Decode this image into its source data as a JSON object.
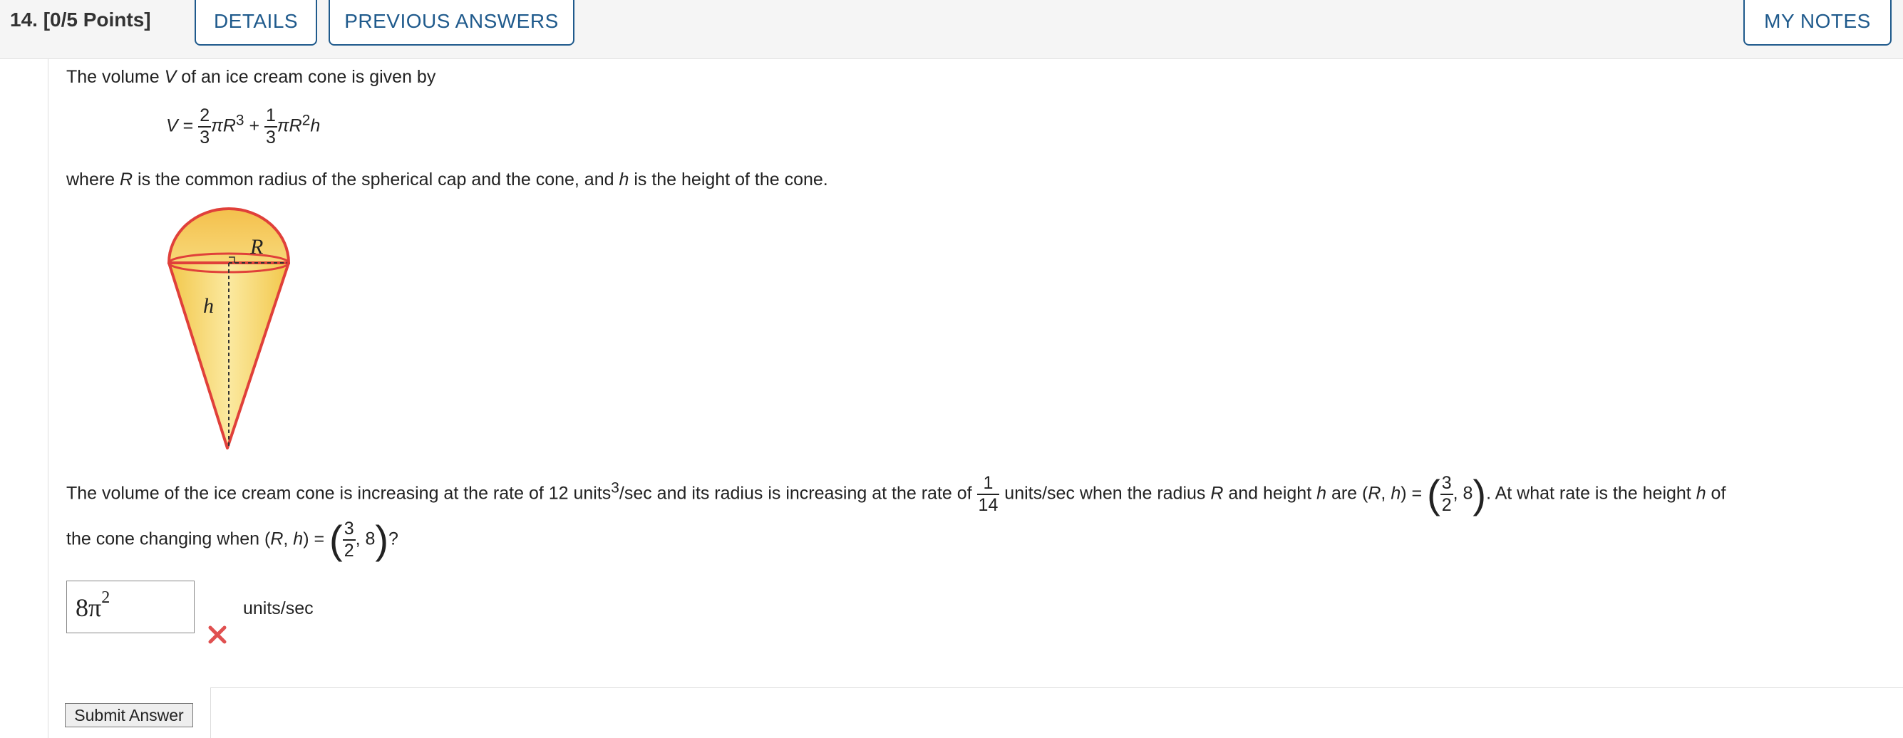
{
  "header": {
    "question_number": "14.",
    "points": "[0/5 Points]",
    "details_label": "DETAILS",
    "previous_answers_label": "PREVIOUS ANSWERS",
    "my_notes_label": "MY NOTES"
  },
  "problem": {
    "intro_pre": "The volume ",
    "intro_var": "V",
    "intro_post": " of an ice cream cone is given by",
    "formula": {
      "lhs": "V",
      "eq": " = ",
      "f1_num": "2",
      "f1_den": "3",
      "t1": "πR",
      "t1_exp": "3",
      "plus": " + ",
      "f2_num": "1",
      "f2_den": "3",
      "t2": "πR",
      "t2_exp": "2",
      "t2_var": "h"
    },
    "where_1": "where ",
    "where_R": "R",
    "where_2": " is the common radius of the spherical cap and the cone, and ",
    "where_h": "h",
    "where_3": " is the height of the cone.",
    "diagram": {
      "label_R": "R",
      "label_h": "h"
    },
    "question": {
      "p1": "The volume of the ice cream cone is increasing at the rate of 12 units",
      "p1_exp": "3",
      "p2": "/sec and its radius is increasing at the rate of ",
      "rate_num": "1",
      "rate_den": "14",
      "p3": " units/sec when the radius ",
      "p3_R": "R",
      "p4": " and height ",
      "p4_h": "h",
      "p5": " are (",
      "p5_R": "R",
      "p5_comma": ", ",
      "p5_h": "h",
      "p6": ") = ",
      "pt_num": "3",
      "pt_den": "2",
      "pt_rest": ", 8",
      "p7": ". At what rate is the height ",
      "p7_h": "h",
      "p8": " of",
      "line2_1": "the cone changing when (",
      "line2_R": "R",
      "line2_comma": ", ",
      "line2_h": "h",
      "line2_2": ") = ",
      "line2_end": "?"
    }
  },
  "answer": {
    "value_base": "8π",
    "value_exp": "2",
    "units": "units/sec",
    "status": "incorrect"
  },
  "submit_label": "Submit Answer",
  "colors": {
    "accent": "#1f5a8c",
    "cone_fill": "#f4cf5b",
    "cone_stroke": "#e0403a",
    "wrong": "#e05050"
  }
}
